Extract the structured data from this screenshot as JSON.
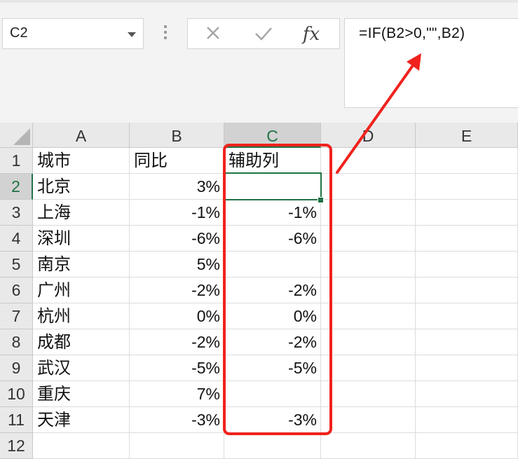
{
  "name_box": {
    "value": "C2"
  },
  "formula_bar": {
    "cancel_icon": "✕",
    "enter_icon": "✓",
    "fx_label": "fx",
    "formula": "=IF(B2>0,\"\",B2)"
  },
  "columns": [
    "A",
    "B",
    "C",
    "D",
    "E"
  ],
  "selected_column": "C",
  "selected_row": "2",
  "rows": [
    {
      "num": "1",
      "a": "城市",
      "b": "同比",
      "c": "辅助列"
    },
    {
      "num": "2",
      "a": "北京",
      "b": "3%",
      "c": ""
    },
    {
      "num": "3",
      "a": "上海",
      "b": "-1%",
      "c": "-1%"
    },
    {
      "num": "4",
      "a": "深圳",
      "b": "-6%",
      "c": "-6%"
    },
    {
      "num": "5",
      "a": "南京",
      "b": "5%",
      "c": ""
    },
    {
      "num": "6",
      "a": "广州",
      "b": "-2%",
      "c": "-2%"
    },
    {
      "num": "7",
      "a": "杭州",
      "b": "0%",
      "c": "0%"
    },
    {
      "num": "8",
      "a": "成都",
      "b": "-2%",
      "c": "-2%"
    },
    {
      "num": "9",
      "a": "武汉",
      "b": "-5%",
      "c": "-5%"
    },
    {
      "num": "10",
      "a": "重庆",
      "b": "7%",
      "c": ""
    },
    {
      "num": "11",
      "a": "天津",
      "b": "-3%",
      "c": "-3%"
    },
    {
      "num": "12",
      "a": "",
      "b": "",
      "c": ""
    }
  ],
  "colors": {
    "annotation": "#f0221d",
    "selection": "#217346"
  }
}
